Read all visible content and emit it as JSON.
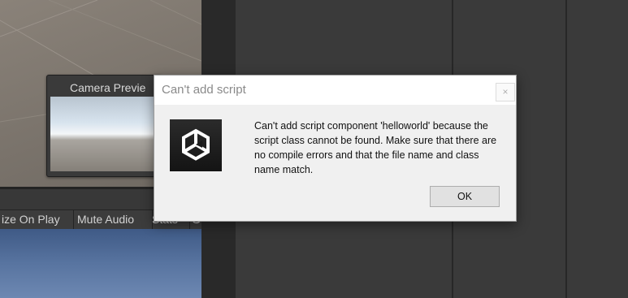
{
  "scene": {
    "camera_preview_title": "Camera Previe"
  },
  "game_toolbar": {
    "items": [
      "ize On Play",
      "Mute Audio",
      "Stats",
      "G"
    ]
  },
  "dialog": {
    "title": "Can't add script",
    "close_glyph": "×",
    "message": "Can't add script component 'helloworld' because the script class cannot be found. Make sure that there are no compile errors and that the file name and class name match.",
    "ok_label": "OK"
  }
}
